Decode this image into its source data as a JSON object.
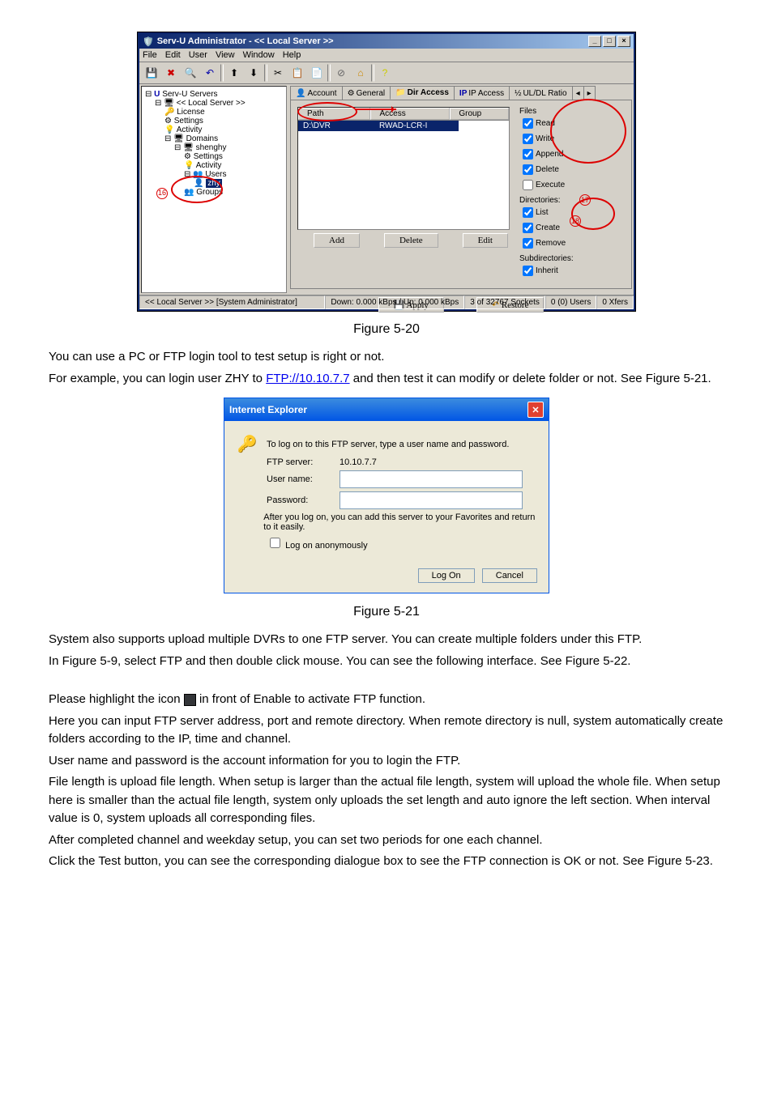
{
  "servu": {
    "title": "Serv-U Administrator - << Local Server >>",
    "menus": [
      "File",
      "Edit",
      "User",
      "View",
      "Window",
      "Help"
    ],
    "tree": {
      "root": "Serv-U Servers",
      "local": "<< Local Server >>",
      "license": "License",
      "settings1": "Settings",
      "activity1": "Activity",
      "domains": "Domains",
      "domain1": "shenghy",
      "settings2": "Settings",
      "activity2": "Activity",
      "users": "Users",
      "user_zhy": "zhy",
      "groups": "Groups"
    },
    "tabs": {
      "account": "Account",
      "general": "General",
      "dir": "Dir Access",
      "ip": "IP Access",
      "ratio": "UL/DL Ratio"
    },
    "list": {
      "h_path": "Path",
      "h_access": "Access",
      "h_group": "Group",
      "row_path": "D:\\DVR",
      "row_access": "RWAD-LCR-I"
    },
    "files_label": "Files",
    "chk": {
      "read": "Read",
      "write": "Write",
      "append": "Append",
      "delete": "Delete",
      "execute": "Execute",
      "dirs": "Directories:",
      "list": "List",
      "create": "Create",
      "remove": "Remove",
      "sub": "Subdirectories:",
      "inherit": "Inherit"
    },
    "btn": {
      "add": "Add",
      "del": "Delete",
      "edit": "Edit",
      "apply": "Apply",
      "restore": "Restore"
    },
    "status": {
      "left": "<< Local Server >>   [System Administrator]",
      "mid": "Down: 0.000 kBps / Up: 0.000 kBps",
      "sock": "3 of 32767 Sockets",
      "users": "0 (0) Users",
      "xfers": "0 Xfers"
    },
    "callout1": "16",
    "callout2": "17",
    "callout3": "18"
  },
  "fig20": "Figure 5-20",
  "p1a": "You can use a PC or FTP login tool to test setup is right or not.",
  "p1b_pre": "For example, you can login user ZHY to ",
  "ftp_link": "FTP://10.10.7.7",
  "p1b_post": "   and then test it can modify or delete folder or not.  See Figure 5-21.",
  "ie": {
    "title": "Internet Explorer",
    "msg": "To log on to this FTP server, type a user name and password.",
    "srv_lbl": "FTP server:",
    "srv_val": "10.10.7.7",
    "user_lbl": "User name:",
    "pass_lbl": "Password:",
    "fav": "After you log on, you can add this server to your Favorites and return to it easily.",
    "anon": "Log on anonymously",
    "logon": "Log On",
    "cancel": "Cancel"
  },
  "fig21": "Figure 5-21",
  "p2": "System also supports upload multiple DVRs to one FTP server. You can create multiple folders under this FTP.",
  "p3": "In Figure 5-9, select FTP and then double click mouse. You can see the following interface. See Figure 5-22.",
  "p4_pre": "Please highlight the icon ",
  "p4_post": " in front of Enable to activate FTP function.",
  "p5": "Here you can input FTP server address, port and remote directory. When remote directory is null, system automatically create folders according to the IP, time and channel.",
  "p6": "User name and password is the account information for you to login the FTP.",
  "p7": "File length is upload file length. When setup is larger than the actual file length, system will upload the whole file. When setup here is smaller than the actual file length, system only uploads the set length and auto ignore the left section. When interval value is 0, system uploads all corresponding files.",
  "p8": "After completed channel and weekday setup, you can set two periods for one each channel.",
  "p9": "Click the Test button, you can see the corresponding dialogue box to see the FTP connection is OK or not.  See Figure 5-23."
}
